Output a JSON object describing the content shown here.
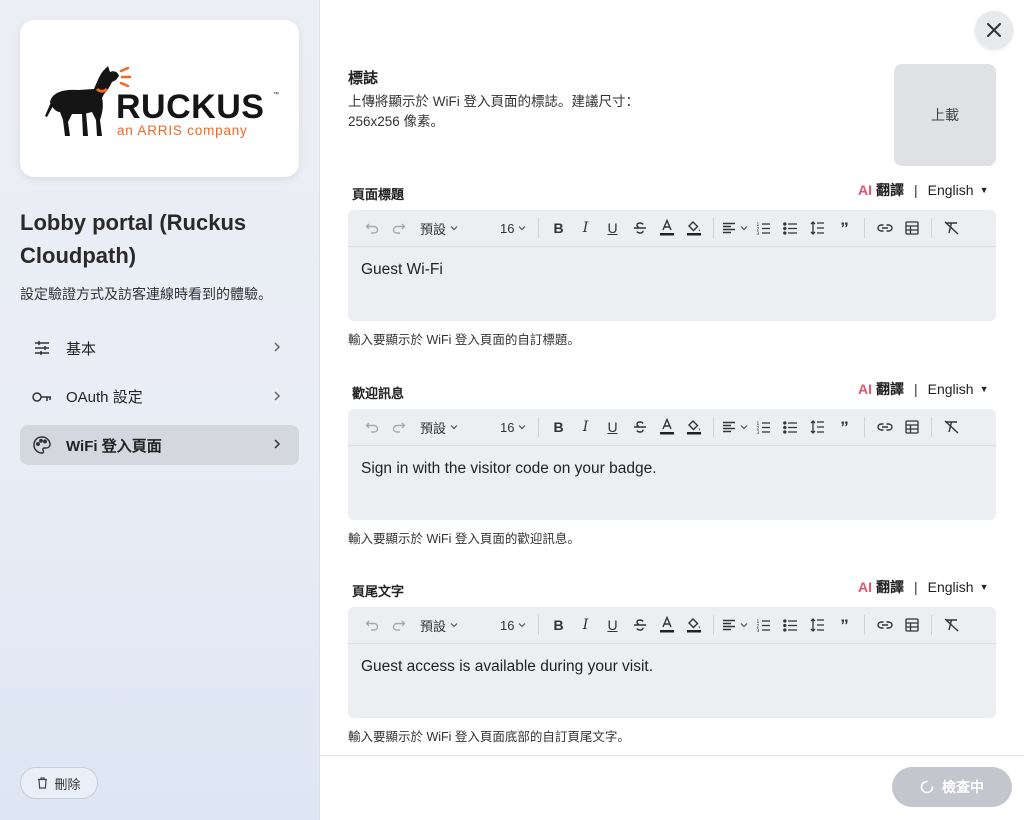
{
  "sidebar": {
    "logo_name": "RUCKUS",
    "logo_tagline": "an ARRIS company",
    "title": "Lobby portal (Ruckus Cloudpath)",
    "subtitle": "設定驗證方式及訪客連線時看到的體驗。",
    "items": [
      {
        "label": "基本",
        "icon": "sliders-icon"
      },
      {
        "label": "OAuth 設定",
        "icon": "key-icon"
      },
      {
        "label": "WiFi 登入頁面",
        "icon": "palette-icon",
        "active": true
      }
    ],
    "delete_label": "刪除"
  },
  "logo_section": {
    "title": "標誌",
    "description": "上傳將顯示於 WiFi 登入頁面的標誌。建議尺寸：256x256 像素。",
    "upload_label": "上載"
  },
  "translate": {
    "ai": "AI",
    "label": "翻譯",
    "separator": "|",
    "language": "English"
  },
  "toolbar": {
    "style_select": "預設",
    "size_select": "16"
  },
  "fields": [
    {
      "label": "頁面標題",
      "content": "Guest Wi-Fi",
      "helper": "輸入要顯示於 WiFi 登入頁面的自訂標題。"
    },
    {
      "label": "歡迎訊息",
      "content": "Sign in with the visitor code on your badge.",
      "helper": "輸入要顯示於 WiFi 登入頁面的歡迎訊息。"
    },
    {
      "label": "頁尾文字",
      "content": "Guest access is available during your visit.",
      "helper": "輸入要顯示於 WiFi 登入頁面底部的自訂頁尾文字。"
    }
  ],
  "footer": {
    "check_label": "檢查中"
  },
  "colors": {
    "ai_accent": "#e0556b",
    "active_nav": "#d4d7de",
    "logo_orange": "#f26722"
  }
}
